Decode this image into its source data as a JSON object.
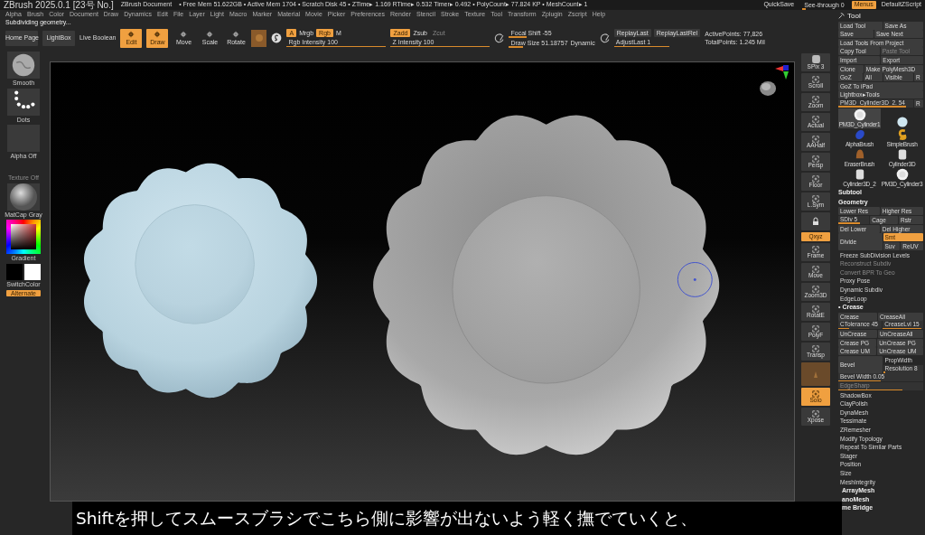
{
  "title_bar": {
    "app": "ZBrush 2025.0.1 [23号 No.]",
    "document": "ZBrush Document",
    "stats": "• Free Mem 51.622GB • Active Mem 1704 • Scratch Disk 45 • ZTime▸ 1.169 RTime▸ 0.532 Timer▸ 0.492 • PolyCount▸ 77.824 KP • MeshCount▸ 1",
    "quicksave": "QuickSave",
    "see_through": {
      "label": "See-through 0",
      "level": 0.08
    },
    "menus_button": {
      "label": "Menus",
      "on": true
    },
    "script": "DefaultZScript"
  },
  "menu": [
    "Alpha",
    "Brush",
    "Color",
    "Document",
    "Draw",
    "Dynamics",
    "Edit",
    "File",
    "Layer",
    "Light",
    "Macro",
    "Marker",
    "Material",
    "Movie",
    "Picker",
    "Preferences",
    "Render",
    "Stencil",
    "Stroke",
    "Texture",
    "Tool",
    "Transform",
    "Zplugin",
    "Zscript",
    "Help"
  ],
  "status": "Subdividing geometry...",
  "toolbar": {
    "buttons": [
      "Home Page",
      "LightBox"
    ],
    "live_boolean": "Live Boolean",
    "modes": [
      {
        "label": "Edit",
        "selected": true
      },
      {
        "label": "Draw",
        "selected": true
      },
      {
        "label": "Move",
        "selected": false
      },
      {
        "label": "Scale",
        "selected": false
      },
      {
        "label": "Rotate",
        "selected": false
      }
    ],
    "color_modes": [
      {
        "label": "A",
        "selected": true
      },
      {
        "label": "Mrgb",
        "selected": false
      },
      {
        "label": "Rgb",
        "selected": true
      },
      {
        "label": "M",
        "selected": false
      }
    ],
    "z_modes": [
      {
        "label": "Zadd",
        "selected": true,
        "disabled": false
      },
      {
        "label": "Zsub",
        "selected": false,
        "disabled": false
      },
      {
        "label": "Zcut",
        "selected": false,
        "disabled": true
      }
    ],
    "rgb_intensity": {
      "label": "Rgb Intensity 100",
      "level": 1
    },
    "z_intensity": {
      "label": "Z Intensity 100",
      "level": 1
    },
    "focal_shift": {
      "label": "Focal Shift -55",
      "level": 0.22
    },
    "draw_size": {
      "label": "Draw Size 51.18757",
      "level": 0.25
    },
    "dynamic": "Dynamic",
    "replay": [
      "ReplayLast",
      "ReplayLastRel"
    ],
    "adjust_last": {
      "label": "AdjustLast 1",
      "level": 0.72
    },
    "active_points": "ActivePoints: 77,826",
    "total_points": "TotalPoints: 1.245 Mil"
  },
  "left_shelf": [
    {
      "kind": "brush",
      "label": "Smooth"
    },
    {
      "kind": "stroke",
      "label": "Dots"
    },
    {
      "kind": "alpha",
      "label": "Alpha Off"
    },
    {
      "kind": "texture",
      "label": "Texture Off"
    },
    {
      "kind": "material",
      "label": "MatCap Gray"
    },
    {
      "kind": "color",
      "label": "Gradient"
    },
    {
      "kind": "swatches",
      "label": "SwitchColor"
    },
    {
      "kind": "toggle",
      "label": "Alternate",
      "on": true
    }
  ],
  "right_shelf": [
    {
      "kind": "spix",
      "label": "SPix 3",
      "selected": false
    },
    {
      "kind": "icon",
      "label": "Scroll",
      "selected": false
    },
    {
      "kind": "icon",
      "label": "Zoom",
      "selected": false
    },
    {
      "kind": "icon",
      "label": "Actual",
      "selected": false
    },
    {
      "kind": "icon",
      "label": "AAHalf",
      "selected": false
    },
    {
      "kind": "icon",
      "label": "Persp",
      "selected": false
    },
    {
      "kind": "icon",
      "label": "Floor",
      "selected": false
    },
    {
      "kind": "icon",
      "label": "L.Sym",
      "selected": false
    },
    {
      "kind": "lock",
      "selected": false
    },
    {
      "kind": "toggle",
      "label": "Qxyz",
      "selected": true
    },
    {
      "kind": "icon",
      "label": "Frame",
      "selected": false
    },
    {
      "kind": "icon",
      "label": "Move",
      "selected": false
    },
    {
      "kind": "icon",
      "label": "Zoom3D",
      "selected": false
    },
    {
      "kind": "icon",
      "label": "RotatE",
      "selected": false
    },
    {
      "kind": "icon",
      "label": "PolyF",
      "selected": false
    },
    {
      "kind": "icon",
      "label": "Transp",
      "selected": false
    },
    {
      "kind": "ghost",
      "selected": false
    },
    {
      "kind": "icon",
      "label": "Solo",
      "selected": true
    },
    {
      "kind": "icon",
      "label": "Xpose",
      "selected": false
    }
  ],
  "tool_panel": {
    "title": "Tool",
    "rows": [
      {
        "kind": "buttons",
        "items": [
          {
            "kind": "button",
            "text": "Load Tool"
          },
          {
            "kind": "button",
            "text": "Save As"
          }
        ]
      },
      {
        "kind": "buttons",
        "items": [
          {
            "kind": "button",
            "text": "Save"
          },
          {
            "kind": "button",
            "text": "Save Next"
          }
        ]
      },
      {
        "kind": "buttons",
        "items": [
          {
            "kind": "button",
            "text": "Load Tools From Project"
          }
        ]
      },
      {
        "kind": "buttons",
        "items": [
          {
            "kind": "button",
            "text": "Copy Tool"
          },
          {
            "kind": "button",
            "text": "Paste Tool",
            "disabled": true
          }
        ]
      },
      {
        "kind": "buttons",
        "items": [
          {
            "kind": "button",
            "text": "Import"
          },
          {
            "kind": "button",
            "text": "Export"
          }
        ]
      },
      {
        "kind": "buttons",
        "items": [
          {
            "kind": "button",
            "text": "Clone"
          },
          {
            "kind": "button",
            "text": "Make PolyMesh3D"
          }
        ]
      },
      {
        "kind": "buttons",
        "items": [
          {
            "kind": "button",
            "text": "GoZ"
          },
          {
            "kind": "button",
            "text": "All"
          },
          {
            "kind": "button",
            "text": "Visible"
          },
          {
            "kind": "button",
            "text": "R"
          }
        ]
      },
      {
        "kind": "buttons",
        "items": [
          {
            "kind": "button",
            "text": "GoZ To iPad"
          }
        ]
      },
      {
        "kind": "buttons",
        "items": [
          {
            "kind": "button",
            "text": "Lightbox▸Tools"
          }
        ]
      },
      {
        "kind": "buttons",
        "items": [
          {
            "kind": "slider",
            "text": "PM3D_Cylinder3D_2. 54",
            "level": 0.9
          },
          {
            "kind": "button",
            "text": "R"
          }
        ]
      },
      {
        "kind": "thumbs",
        "items": [
          {
            "kind": "plate",
            "label": "PM3D_Cylinder1",
            "selected": true
          },
          {
            "kind": "sphere",
            "selected": false
          },
          {
            "kind": "alpha-brush",
            "label": "AlphaBrush",
            "selected": false
          },
          {
            "kind": "simple-brush",
            "label": "SimpleBrush",
            "selected": false
          },
          {
            "kind": "eraser",
            "label": "EraserBrush",
            "selected": false
          },
          {
            "kind": "cylinder",
            "label": "Cylinder3D",
            "selected": false
          },
          {
            "kind": "cylinder",
            "label": "Cylinder3D_2",
            "selected": false
          },
          {
            "kind": "plate",
            "label": "PM3D_Cylinder3",
            "selected": false
          }
        ]
      },
      {
        "kind": "header",
        "text": "Subtool"
      },
      {
        "kind": "header",
        "text": "Geometry"
      },
      {
        "kind": "buttons",
        "items": [
          {
            "kind": "button",
            "text": "Lower Res"
          },
          {
            "kind": "button",
            "text": "Higher Res"
          }
        ]
      },
      {
        "kind": "buttons",
        "items": [
          {
            "kind": "slider",
            "text": "SDiv 5",
            "level": 0.7
          },
          {
            "kind": "button",
            "text": "Cage"
          },
          {
            "kind": "button",
            "text": "Rstr"
          }
        ]
      },
      {
        "kind": "buttons",
        "items": [
          {
            "kind": "button",
            "text": "Del Lower"
          },
          {
            "kind": "button",
            "text": "Del Higher"
          }
        ]
      },
      {
        "kind": "split",
        "left": {
          "kind": "button",
          "text": "Divide"
        },
        "right": [
          [
            {
              "kind": "button",
              "text": "Smt",
              "selected": true
            }
          ],
          [
            {
              "kind": "button",
              "text": "Suv"
            },
            {
              "kind": "button",
              "text": "ReUV"
            }
          ]
        ]
      },
      {
        "kind": "buttons",
        "items": [
          {
            "kind": "item",
            "text": "Freeze SubDivision Levels"
          }
        ]
      },
      {
        "kind": "buttons",
        "items": [
          {
            "kind": "item",
            "text": "Reconstruct Subdiv",
            "disabled": true
          }
        ]
      },
      {
        "kind": "buttons",
        "items": [
          {
            "kind": "item",
            "text": "Convert BPR To Geo",
            "disabled": true
          }
        ]
      },
      {
        "kind": "buttons",
        "items": [
          {
            "kind": "item",
            "text": "Proxy Pose"
          }
        ]
      },
      {
        "kind": "buttons",
        "items": [
          {
            "kind": "item",
            "text": "Dynamic Subdiv"
          }
        ]
      },
      {
        "kind": "buttons",
        "items": [
          {
            "kind": "item",
            "text": "EdgeLoop"
          }
        ]
      },
      {
        "kind": "header",
        "text": "• Crease"
      },
      {
        "kind": "buttons",
        "items": [
          {
            "kind": "button",
            "text": "Crease"
          },
          {
            "kind": "button",
            "text": "CreaseAll"
          }
        ]
      },
      {
        "kind": "buttons",
        "items": [
          {
            "kind": "slider",
            "text": "CTolerance 45",
            "level": 0.25
          },
          {
            "kind": "slider",
            "text": "CreaseLvl 15",
            "level": 0.95
          }
        ]
      },
      {
        "kind": "buttons",
        "items": [
          {
            "kind": "button",
            "text": "UnCrease"
          },
          {
            "kind": "button",
            "text": "UnCreaseAll"
          }
        ]
      },
      {
        "kind": "buttons",
        "items": [
          {
            "kind": "button",
            "text": "Crease PG"
          },
          {
            "kind": "button",
            "text": "UnCrease PG"
          }
        ]
      },
      {
        "kind": "buttons",
        "items": [
          {
            "kind": "button",
            "text": "Crease UM"
          },
          {
            "kind": "button",
            "text": "UnCrease UM"
          }
        ]
      },
      {
        "kind": "split",
        "left": {
          "kind": "button",
          "text": "Bevel"
        },
        "right": [
          [
            {
              "kind": "item",
              "text": "PropWidth"
            }
          ],
          [
            {
              "kind": "slider",
              "text": "Resolution 8",
              "level": 0.05
            }
          ]
        ]
      },
      {
        "kind": "buttons",
        "items": [
          {
            "kind": "slider",
            "text": "Bevel Width 0.05",
            "level": 0.5
          }
        ]
      },
      {
        "kind": "buttons",
        "items": [
          {
            "kind": "slider",
            "text": "EdgeSharp",
            "level": 0.75,
            "disabled": true
          }
        ]
      },
      {
        "kind": "buttons",
        "items": [
          {
            "kind": "item",
            "text": "ShadowBox"
          }
        ]
      },
      {
        "kind": "buttons",
        "items": [
          {
            "kind": "item",
            "text": "ClayPolish"
          }
        ]
      },
      {
        "kind": "buttons",
        "items": [
          {
            "kind": "item",
            "text": "DynaMesh"
          }
        ]
      },
      {
        "kind": "buttons",
        "items": [
          {
            "kind": "item",
            "text": "Tessimate"
          }
        ]
      },
      {
        "kind": "buttons",
        "items": [
          {
            "kind": "item",
            "text": "ZRemesher"
          }
        ]
      },
      {
        "kind": "buttons",
        "items": [
          {
            "kind": "item",
            "text": "Modify Topology"
          }
        ]
      },
      {
        "kind": "buttons",
        "items": [
          {
            "kind": "item",
            "text": "Repeat To Similar Parts"
          }
        ]
      },
      {
        "kind": "buttons",
        "items": [
          {
            "kind": "item",
            "text": "Stager"
          }
        ]
      },
      {
        "kind": "buttons",
        "items": [
          {
            "kind": "item",
            "text": "Position"
          }
        ]
      },
      {
        "kind": "buttons",
        "items": [
          {
            "kind": "item",
            "text": "Size"
          }
        ]
      },
      {
        "kind": "buttons",
        "items": [
          {
            "kind": "item",
            "text": "MeshIntegrity"
          }
        ]
      }
    ],
    "after": [
      "ArrayMesh",
      "anoMesh",
      "me Bridge"
    ]
  },
  "caption": "Shiftを押してスムースブラシでこちら側に影響が出ないよう軽く撫でていくと、"
}
